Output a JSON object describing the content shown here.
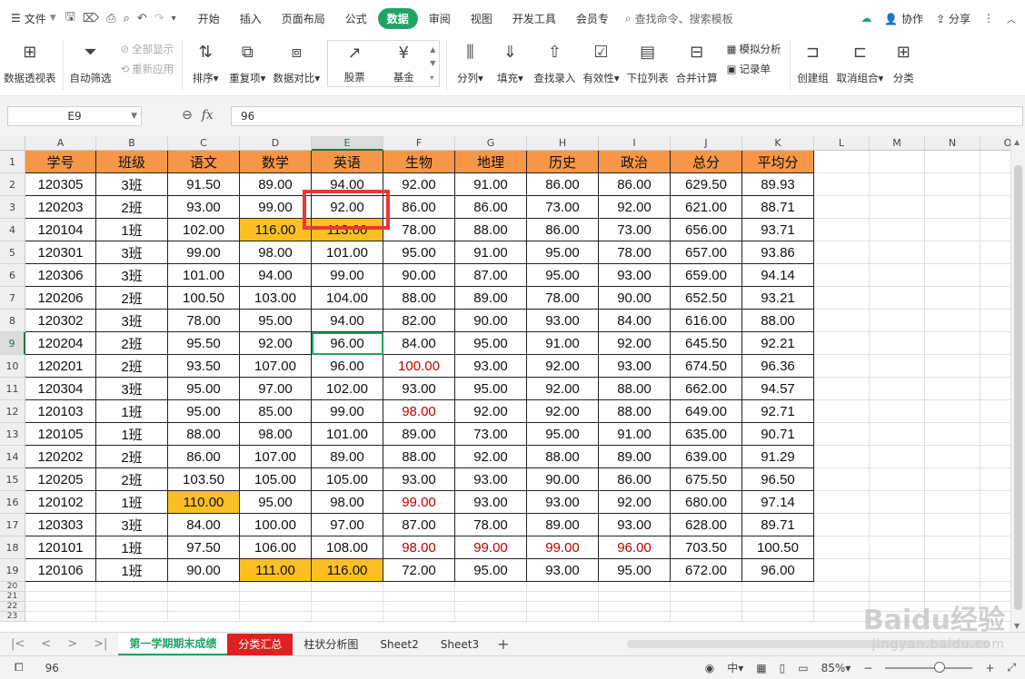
{
  "menubar": {
    "file_label": "文件",
    "tabs": [
      "开始",
      "插入",
      "页面布局",
      "公式",
      "数据",
      "审阅",
      "视图",
      "开发工具",
      "会员专"
    ],
    "search_placeholder": "查找命令、搜索模板",
    "collab_label": "协作",
    "share_label": "分享"
  },
  "ribbon": {
    "pivot": "数据透视表",
    "autofilter": "自动筛选",
    "show_all": "全部显示",
    "reapply": "重新应用",
    "sort": "排序",
    "duplicates": "重复项",
    "compare": "数据对比",
    "stocks": "股票",
    "funds": "基金",
    "split": "分列",
    "fill": "填充",
    "lookup": "查找录入",
    "validity": "有效性",
    "dropdown": "下拉列表",
    "consolidate": "合并计算",
    "whatif": "模拟分析",
    "record": "记录单",
    "group": "创建组",
    "ungroup": "取消组合",
    "subtotal": "分类"
  },
  "formula_bar": {
    "name_box": "E9",
    "fx_label": "fx",
    "value": "96"
  },
  "columns": [
    "A",
    "B",
    "C",
    "D",
    "E",
    "F",
    "G",
    "H",
    "I",
    "J",
    "K",
    "L",
    "M",
    "N",
    "O"
  ],
  "header_row": [
    "学号",
    "班级",
    "语文",
    "数学",
    "英语",
    "生物",
    "地理",
    "历史",
    "政治",
    "总分",
    "平均分"
  ],
  "rows": [
    [
      "120305",
      "3班",
      "91.50",
      "89.00",
      "94.00",
      "92.00",
      "91.00",
      "86.00",
      "86.00",
      "629.50",
      "89.93"
    ],
    [
      "120203",
      "2班",
      "93.00",
      "99.00",
      "92.00",
      "86.00",
      "86.00",
      "73.00",
      "92.00",
      "621.00",
      "88.71"
    ],
    [
      "120104",
      "1班",
      "102.00",
      "116.00",
      "113.00",
      "78.00",
      "88.00",
      "86.00",
      "73.00",
      "656.00",
      "93.71"
    ],
    [
      "120301",
      "3班",
      "99.00",
      "98.00",
      "101.00",
      "95.00",
      "91.00",
      "95.00",
      "78.00",
      "657.00",
      "93.86"
    ],
    [
      "120306",
      "3班",
      "101.00",
      "94.00",
      "99.00",
      "90.00",
      "87.00",
      "95.00",
      "93.00",
      "659.00",
      "94.14"
    ],
    [
      "120206",
      "2班",
      "100.50",
      "103.00",
      "104.00",
      "88.00",
      "89.00",
      "78.00",
      "90.00",
      "652.50",
      "93.21"
    ],
    [
      "120302",
      "3班",
      "78.00",
      "95.00",
      "94.00",
      "82.00",
      "90.00",
      "93.00",
      "84.00",
      "616.00",
      "88.00"
    ],
    [
      "120204",
      "2班",
      "95.50",
      "92.00",
      "96.00",
      "84.00",
      "95.00",
      "91.00",
      "92.00",
      "645.50",
      "92.21"
    ],
    [
      "120201",
      "2班",
      "93.50",
      "107.00",
      "96.00",
      "100.00",
      "93.00",
      "92.00",
      "93.00",
      "674.50",
      "96.36"
    ],
    [
      "120304",
      "3班",
      "95.00",
      "97.00",
      "102.00",
      "93.00",
      "95.00",
      "92.00",
      "88.00",
      "662.00",
      "94.57"
    ],
    [
      "120103",
      "1班",
      "95.00",
      "85.00",
      "99.00",
      "98.00",
      "92.00",
      "92.00",
      "88.00",
      "649.00",
      "92.71"
    ],
    [
      "120105",
      "1班",
      "88.00",
      "98.00",
      "101.00",
      "89.00",
      "73.00",
      "95.00",
      "91.00",
      "635.00",
      "90.71"
    ],
    [
      "120202",
      "2班",
      "86.00",
      "107.00",
      "89.00",
      "88.00",
      "92.00",
      "88.00",
      "89.00",
      "639.00",
      "91.29"
    ],
    [
      "120205",
      "2班",
      "103.50",
      "105.00",
      "105.00",
      "93.00",
      "93.00",
      "90.00",
      "86.00",
      "675.50",
      "96.50"
    ],
    [
      "120102",
      "1班",
      "110.00",
      "95.00",
      "98.00",
      "99.00",
      "93.00",
      "93.00",
      "92.00",
      "680.00",
      "97.14"
    ],
    [
      "120303",
      "3班",
      "84.00",
      "100.00",
      "97.00",
      "87.00",
      "78.00",
      "89.00",
      "93.00",
      "628.00",
      "89.71"
    ],
    [
      "120101",
      "1班",
      "97.50",
      "106.00",
      "108.00",
      "98.00",
      "99.00",
      "99.00",
      "96.00",
      "703.50",
      "100.50"
    ],
    [
      "120106",
      "1班",
      "90.00",
      "111.00",
      "116.00",
      "72.00",
      "95.00",
      "93.00",
      "95.00",
      "672.00",
      "96.00"
    ]
  ],
  "highlight_cells": [
    "4-3",
    "4-4",
    "16-2",
    "19-3",
    "19-4"
  ],
  "red_text_cells": [
    "10-5",
    "12-5",
    "16-5",
    "18-5",
    "18-6",
    "18-7",
    "18-8"
  ],
  "active_cell": "9-4",
  "empty_rows": [
    "20",
    "21",
    "22",
    "23"
  ],
  "sheets": [
    "第一学期期末成绩",
    "分类汇总",
    "柱状分析图",
    "Sheet2",
    "Sheet3"
  ],
  "status": {
    "value": "96",
    "zoom": "85%"
  },
  "watermark": {
    "brand": "Baidu经验",
    "url": "jingyan.baidu.com"
  },
  "colors": {
    "accent": "#21a366",
    "header_fill": "#f79646",
    "highlight_fill": "#fbbf24",
    "red_text": "#c00000",
    "annotation_box": "#e53935"
  }
}
